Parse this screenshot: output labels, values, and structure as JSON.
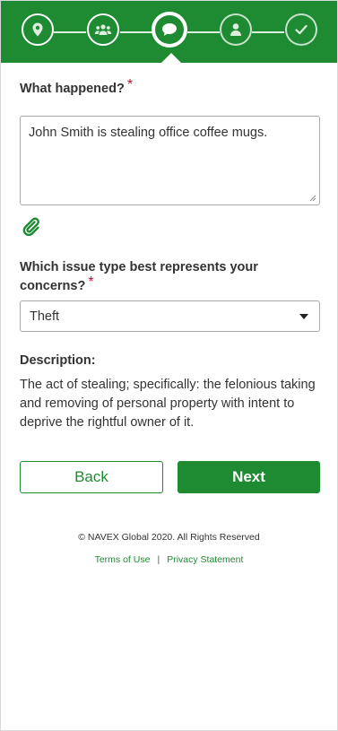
{
  "stepper": {
    "steps": [
      {
        "icon": "location-pin-icon",
        "state": "done"
      },
      {
        "icon": "people-icon",
        "state": "done"
      },
      {
        "icon": "chat-bubble-icon",
        "state": "active"
      },
      {
        "icon": "person-icon",
        "state": "upcoming"
      },
      {
        "icon": "checkmark-icon",
        "state": "upcoming"
      }
    ],
    "color": "#1e8a32"
  },
  "form": {
    "what_happened_label": "What happened?",
    "required_marker": "*",
    "what_happened_value": "John Smith is stealing office coffee mugs.",
    "attachment_icon": "paperclip-icon",
    "issue_type_label": "Which issue type best represents your concerns?",
    "issue_type_selected": "Theft",
    "description_label": "Description:",
    "description_text": "The act of stealing; specifically: the felonious taking and removing of personal property with intent to deprive the rightful owner of it."
  },
  "actions": {
    "back_label": "Back",
    "next_label": "Next"
  },
  "footer": {
    "copyright": "© NAVEX Global 2020. All Rights Reserved",
    "terms_label": "Terms of Use",
    "separator": "|",
    "privacy_label": "Privacy Statement"
  },
  "colors": {
    "brand_green": "#1e8a32",
    "required_red": "#c8102e"
  }
}
